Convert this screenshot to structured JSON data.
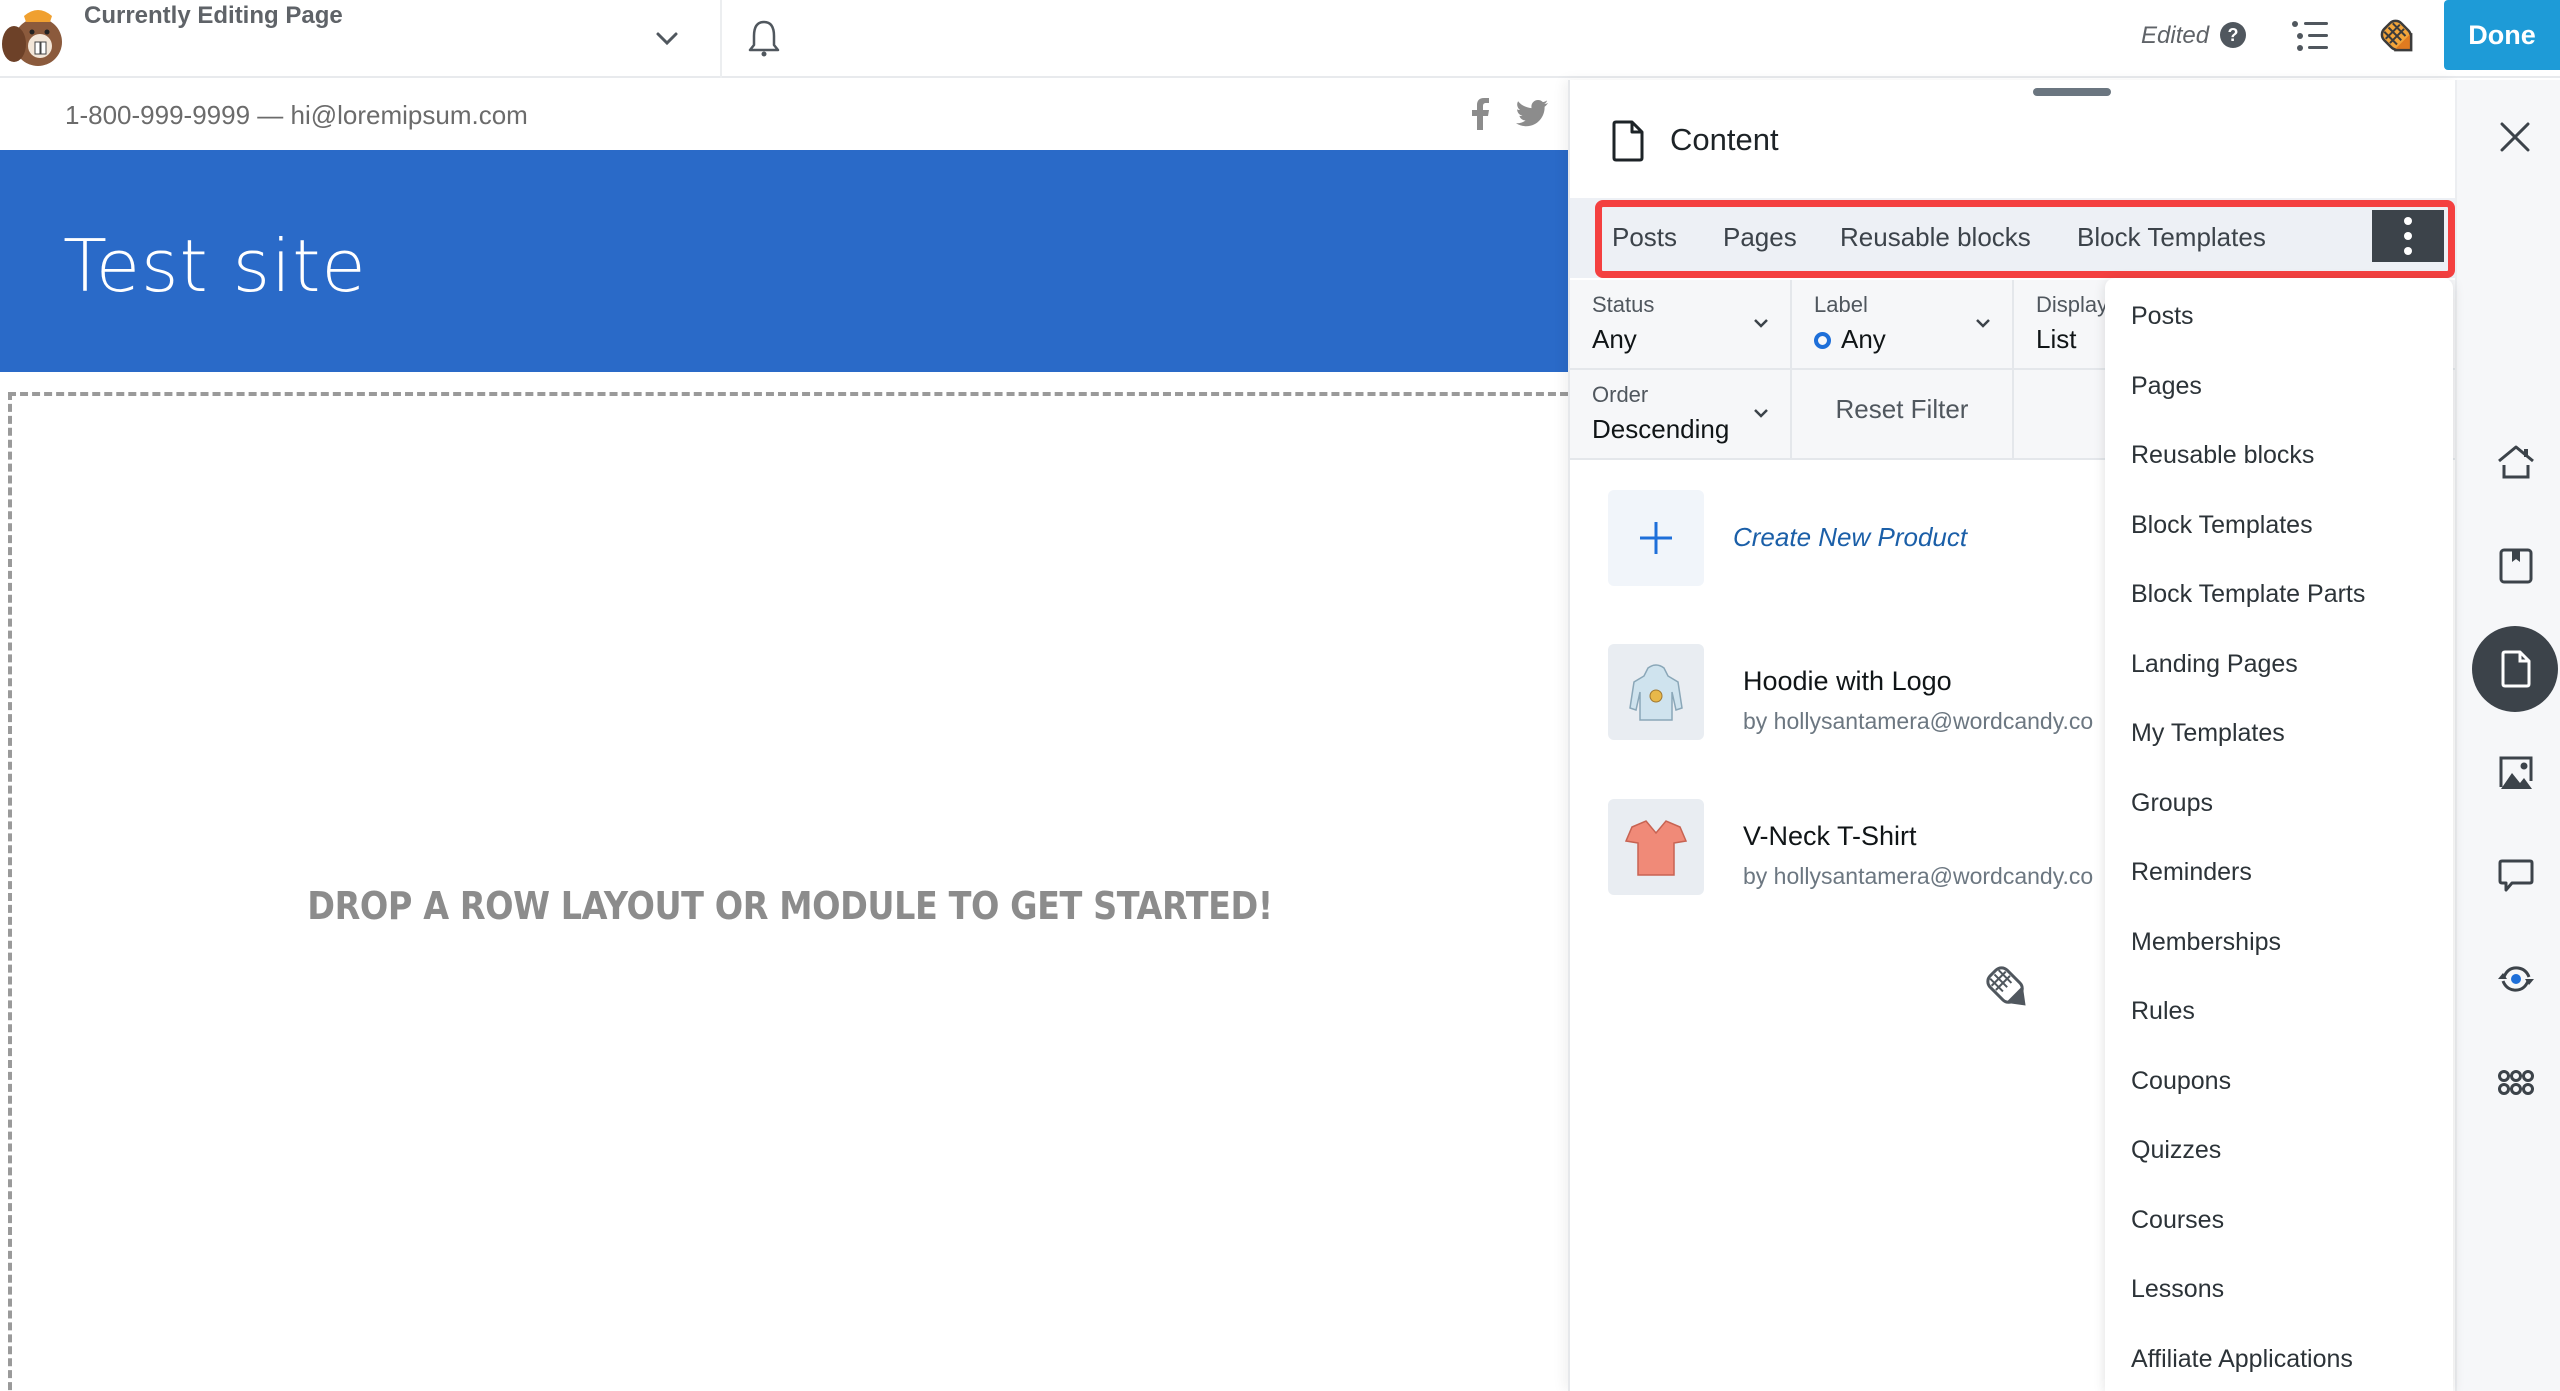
{
  "topbar": {
    "editing_label": "Currently Editing Page",
    "status": "Edited",
    "help_glyph": "?",
    "done_label": "Done",
    "icons": [
      "beaver-logo-icon",
      "chevron-down-icon",
      "bell-icon",
      "help-icon",
      "outline-list-icon",
      "builder-pencil-icon"
    ]
  },
  "page": {
    "contact_line": "1-800-999-9999 — hi@loremipsum.com",
    "social_icons": [
      "facebook-icon",
      "twitter-icon"
    ],
    "site_title": "Test site",
    "drop_message": "DROP A ROW LAYOUT OR MODULE TO GET STARTED!",
    "hero_color": "#2a6ac8"
  },
  "panel": {
    "title": "Content",
    "tabs": [
      {
        "label": "Posts"
      },
      {
        "label": "Pages"
      },
      {
        "label": "Reusable blocks"
      },
      {
        "label": "Block Templates"
      }
    ],
    "highlight_color": "#f44040",
    "filters": {
      "status": {
        "label": "Status",
        "value": "Any"
      },
      "label": {
        "label": "Label",
        "value": "Any"
      },
      "display": {
        "label": "Display",
        "value": "List"
      },
      "order": {
        "label": "Order",
        "value": "Descending"
      },
      "reset_label": "Reset Filter"
    },
    "create_label": "Create New Product",
    "items": [
      {
        "title": "Hoodie with Logo",
        "author": "by hollysantamera@wordcandy.co"
      },
      {
        "title": "V-Neck T-Shirt",
        "author": "by hollysantamera@wordcandy.co"
      }
    ]
  },
  "menu": {
    "items": [
      "Posts",
      "Pages",
      "Reusable blocks",
      "Block Templates",
      "Block Template Parts",
      "Landing Pages",
      "My Templates",
      "Groups",
      "Reminders",
      "Memberships",
      "Rules",
      "Coupons",
      "Quizzes",
      "Courses",
      "Lessons",
      "Affiliate Applications"
    ]
  },
  "rail": {
    "items": [
      {
        "icon": "home-icon",
        "active": false
      },
      {
        "icon": "saved-bookmark-icon",
        "active": false
      },
      {
        "icon": "content-page-icon",
        "active": true
      },
      {
        "icon": "media-image-icon",
        "active": false
      },
      {
        "icon": "comments-icon",
        "active": false
      },
      {
        "icon": "revisions-icon",
        "active": false
      },
      {
        "icon": "apps-grid-icon",
        "active": false
      }
    ]
  },
  "colors": {
    "done_button": "#1e9bd7",
    "label_dot": "#1e6fd9",
    "create_link": "#1b5fa8",
    "active_rail": "#3c434a"
  }
}
